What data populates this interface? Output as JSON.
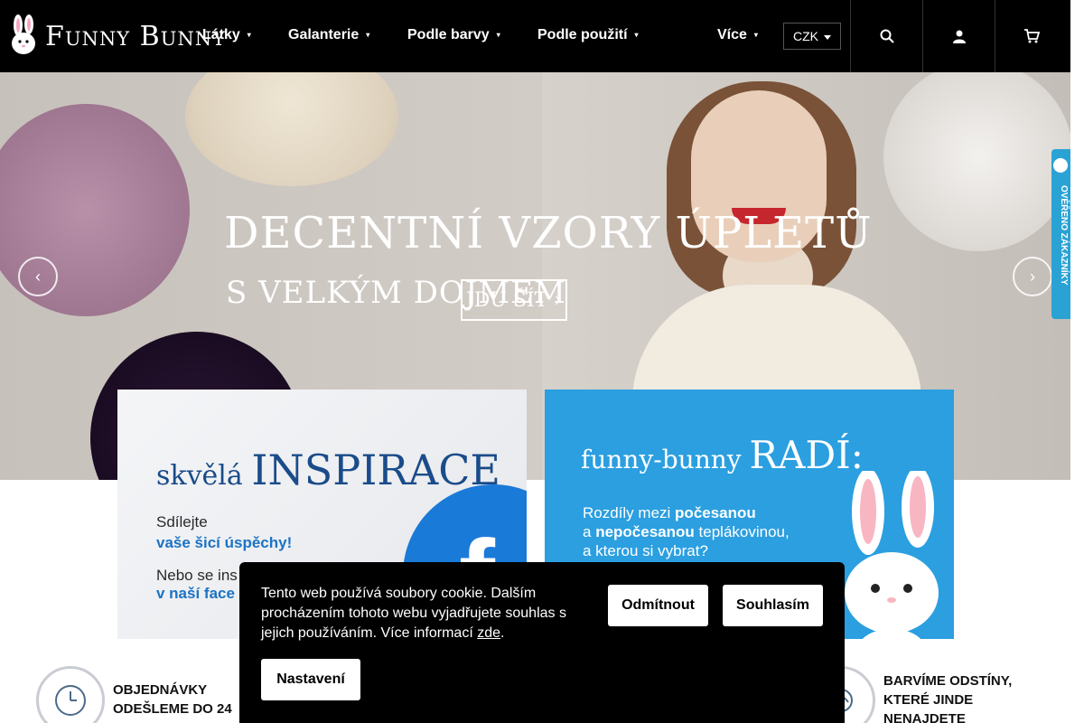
{
  "header": {
    "logo_text": "Funny Bunny",
    "nav": [
      "Látky",
      "Galanterie",
      "Podle barvy",
      "Podle použití",
      "Více"
    ],
    "currency": "CZK",
    "icons": [
      "search-icon",
      "user-icon",
      "cart-icon"
    ]
  },
  "hero": {
    "title_line1": "DECENTNÍ VZORY ÚPLETŮ",
    "title_line2": "S VELKÝM DOJMEM",
    "cta": "JDU ŠÍT ›",
    "prev_arrow": "‹",
    "next_arrow": "›"
  },
  "verified_badge": {
    "text": "OVĚŘENO ZÁKAZNÍKY"
  },
  "promo_left": {
    "title_small": "skvělá",
    "title_big": "INSPIRACE",
    "line1": "Sdílejte",
    "line2": "vaše šicí úspěchy!",
    "line3": "Nebo se ins",
    "line4": "v naší face",
    "fb_letter": "f"
  },
  "promo_right": {
    "title_small": "funny-bunny",
    "title_big": "RADÍ:",
    "text_line1": "Rozdíly mezi",
    "text_bold1": "počesanou",
    "text_line2": "a",
    "text_bold2": "nepočesanou",
    "text_line3": "teplákovinou,",
    "text_line4": "a kterou si vybrat?"
  },
  "features": [
    {
      "icon": "clock-24-icon",
      "text": "OBJEDNÁVKY ODEŠLEME DO 24"
    },
    {
      "icon": "dye-icon",
      "text": "BARVÍME ODSTÍNY, KTERÉ JINDE NENAJDETE"
    }
  ],
  "cookie": {
    "text": "Tento web používá soubory cookie. Dalším procházením tohoto webu vyjadřujete souhlas s jejich používáním. Více informací",
    "link": "zde",
    "period": ".",
    "decline": "Odmítnout",
    "accept": "Souhlasím",
    "settings": "Nastavení"
  }
}
